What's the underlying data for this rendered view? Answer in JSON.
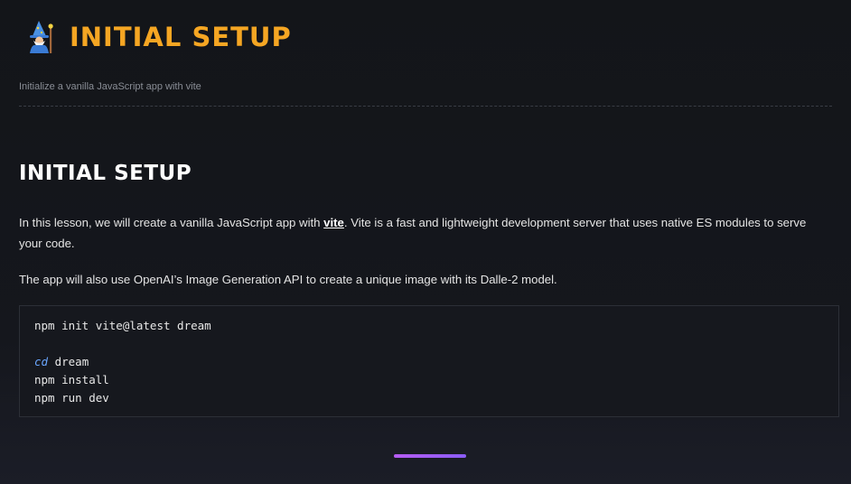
{
  "header": {
    "icon": "wizard-icon",
    "title": "Initial Setup",
    "subtitle": "Initialize a vanilla JavaScript app with vite"
  },
  "main": {
    "heading": "Initial Setup",
    "para1": {
      "before": "In this lesson, we will create a vanilla JavaScript app with ",
      "link": "vite",
      "after": ". Vite is a fast and lightweight development server that uses native ES modules to serve your code."
    },
    "para2": "The app will also use OpenAI’s Image Generation API to create a unique image with its Dalle-2 model.",
    "code": {
      "line1": "npm init vite@latest dream",
      "line2_keyword": "cd",
      "line2_rest": " dream",
      "line3": "npm install",
      "line4": "npm run dev"
    }
  },
  "colors": {
    "title": "#f5a623",
    "link": "#ffffff",
    "keyword": "#6aa6ff",
    "progress": "#b65cf2"
  }
}
